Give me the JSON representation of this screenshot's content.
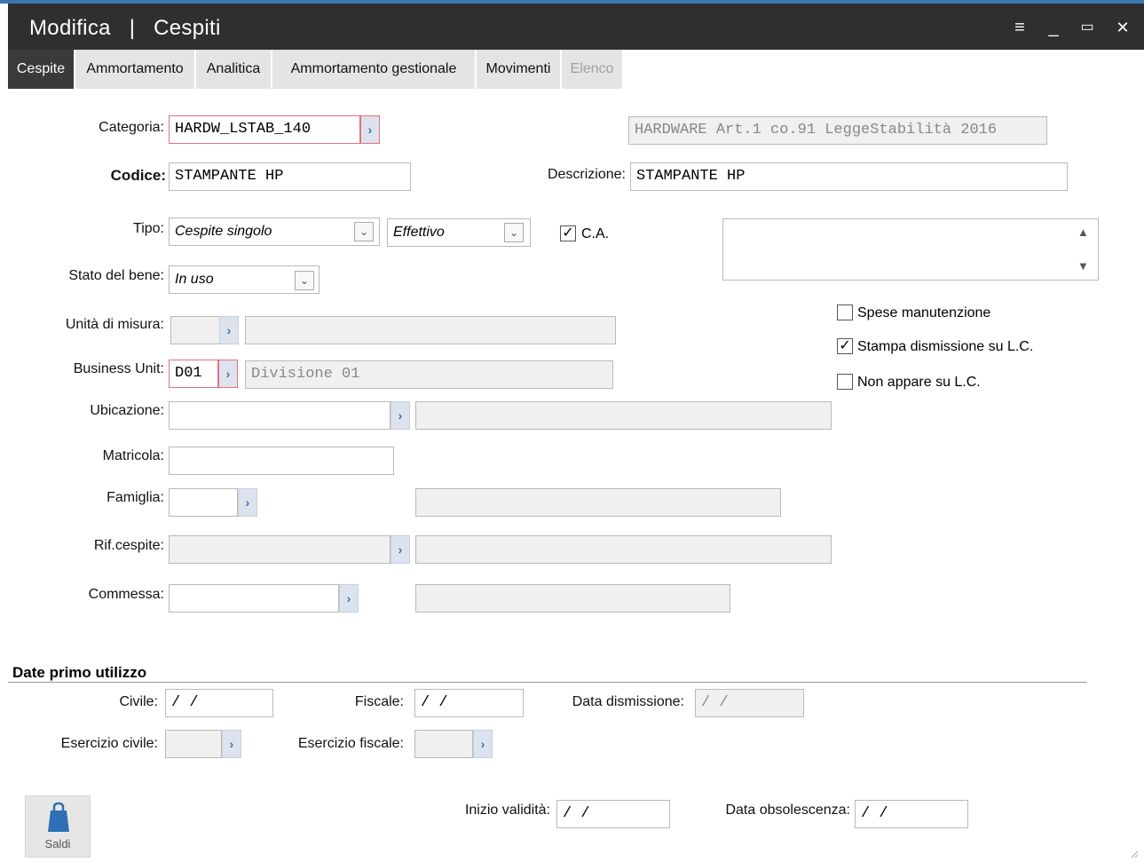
{
  "window": {
    "mode": "Modifica",
    "separator": "|",
    "title": "Cespiti",
    "controls": {
      "menu": "≡",
      "minimize": "_",
      "maximize": "▭",
      "close": "✕"
    }
  },
  "tabs": [
    {
      "label": "Cespite",
      "state": "active"
    },
    {
      "label": "Ammortamento",
      "state": "normal"
    },
    {
      "label": "Analitica",
      "state": "normal"
    },
    {
      "label": "Ammortamento gestionale",
      "state": "normal"
    },
    {
      "label": "Movimenti",
      "state": "normal"
    },
    {
      "label": "Elenco",
      "state": "disabled"
    }
  ],
  "form": {
    "categoria": {
      "label": "Categoria:",
      "value": "HARDW_LSTAB_140",
      "description": "HARDWARE Art.1 co.91 LeggeStabilità 2016"
    },
    "codice": {
      "label": "Codice:",
      "value": "STAMPANTE HP"
    },
    "descrizione": {
      "label": "Descrizione:",
      "value": "STAMPANTE HP"
    },
    "tipo": {
      "label": "Tipo:",
      "value": "Cespite singolo",
      "tipo2": "Effettivo"
    },
    "ca": {
      "label": "C.A.",
      "checked": true
    },
    "stato": {
      "label": "Stato del bene:",
      "value": "In uso"
    },
    "unita": {
      "label": "Unità di misura:",
      "value": "",
      "description": ""
    },
    "business_unit": {
      "label": "Business Unit:",
      "value": "D01",
      "description": "Divisione 01"
    },
    "ubicazione": {
      "label": "Ubicazione:",
      "value": "",
      "description": ""
    },
    "matricola": {
      "label": "Matricola:",
      "value": ""
    },
    "famiglia": {
      "label": "Famiglia:",
      "value": "",
      "description": ""
    },
    "rif_cespite": {
      "label": "Rif.cespite:",
      "value": "",
      "description": ""
    },
    "commessa": {
      "label": "Commessa:",
      "value": "",
      "description": ""
    },
    "spese": {
      "label": "Spese manutenzione",
      "checked": false
    },
    "stampa": {
      "label": "Stampa dismissione su L.C.",
      "checked": true
    },
    "non_appare": {
      "label": "Non appare su L.C.",
      "checked": false
    }
  },
  "date_section": {
    "title": "Date primo utilizzo",
    "civile": {
      "label": "Civile:",
      "value": " /  /"
    },
    "fiscale": {
      "label": "Fiscale:",
      "value": " /  /"
    },
    "dismissione": {
      "label": "Data dismissione:",
      "value": " /  /"
    },
    "esercizio_civile": {
      "label": "Esercizio civile:",
      "value": ""
    },
    "esercizio_fiscale": {
      "label": "Esercizio fiscale:",
      "value": ""
    },
    "inizio_validita": {
      "label": "Inizio validità:",
      "value": " /  /"
    },
    "obsolescenza": {
      "label": "Data obsolescenza:",
      "value": " /  /"
    }
  },
  "buttons": {
    "saldi": "Saldi"
  },
  "colors": {
    "accent": "#3d77b3",
    "titlebar": "#2f2f2f",
    "required_border": "#e0727a",
    "readonly_bg": "#f0f0f0"
  },
  "icons": {
    "zoom": "chevron-right-icon",
    "saldi": "shopping-bag-icon",
    "dropdown": "chevron-down-icon"
  }
}
